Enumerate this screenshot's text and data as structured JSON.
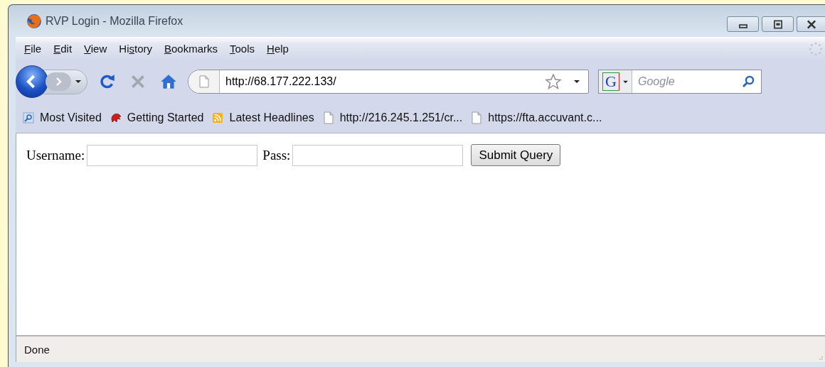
{
  "window": {
    "title": "RVP Login - Mozilla Firefox"
  },
  "menu": [
    {
      "key": "F",
      "rest": "ile"
    },
    {
      "key": "E",
      "rest": "dit"
    },
    {
      "key": "V",
      "rest": "iew"
    },
    {
      "before": "Hi",
      "key": "s",
      "rest": "tory"
    },
    {
      "key": "B",
      "rest": "ookmarks"
    },
    {
      "key": "T",
      "rest": "ools"
    },
    {
      "key": "H",
      "rest": "elp"
    }
  ],
  "navigation": {
    "back_disabled": false,
    "forward_disabled": true,
    "stop_disabled": true,
    "address": "http://68.177.222.133/",
    "bookmarked": false
  },
  "search": {
    "engine_logo": "G",
    "placeholder": "Google"
  },
  "bookmarks": [
    {
      "kind": "smart",
      "label": "Most Visited"
    },
    {
      "kind": "getting-started",
      "label": "Getting Started"
    },
    {
      "kind": "feed",
      "label": "Latest Headlines"
    },
    {
      "kind": "page",
      "label": "http://216.245.1.251/cr..."
    },
    {
      "kind": "page",
      "label": "https://fta.accuvant.c..."
    }
  ],
  "form": {
    "username_label": "Username:",
    "password_label": "Pass:",
    "submit": "Submit Query"
  },
  "status_bar": {
    "text": "Done"
  }
}
